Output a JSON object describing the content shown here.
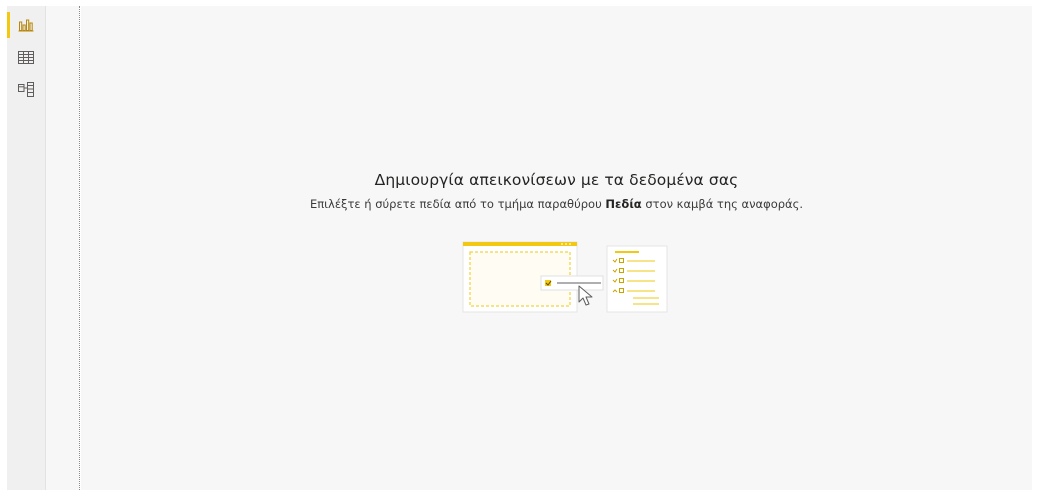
{
  "nav": {
    "items": [
      {
        "name": "report-view",
        "icon": "bar-chart-icon",
        "active": true
      },
      {
        "name": "data-view",
        "icon": "table-grid-icon",
        "active": false
      },
      {
        "name": "model-view",
        "icon": "model-diagram-icon",
        "active": false
      }
    ]
  },
  "empty_state": {
    "title": "Δημιουργία απεικονίσεων με τα δεδομένα σας",
    "subtitle_before": "Επιλέξτε ή σύρετε πεδία από το τμήμα παραθύρου ",
    "subtitle_bold": "Πεδία",
    "subtitle_after": " στον καμβά της αναφοράς."
  },
  "colors": {
    "accent": "#f2c811",
    "nav_bg": "#f0f0f0",
    "canvas_bg": "#f7f7f7",
    "text": "#252423"
  }
}
